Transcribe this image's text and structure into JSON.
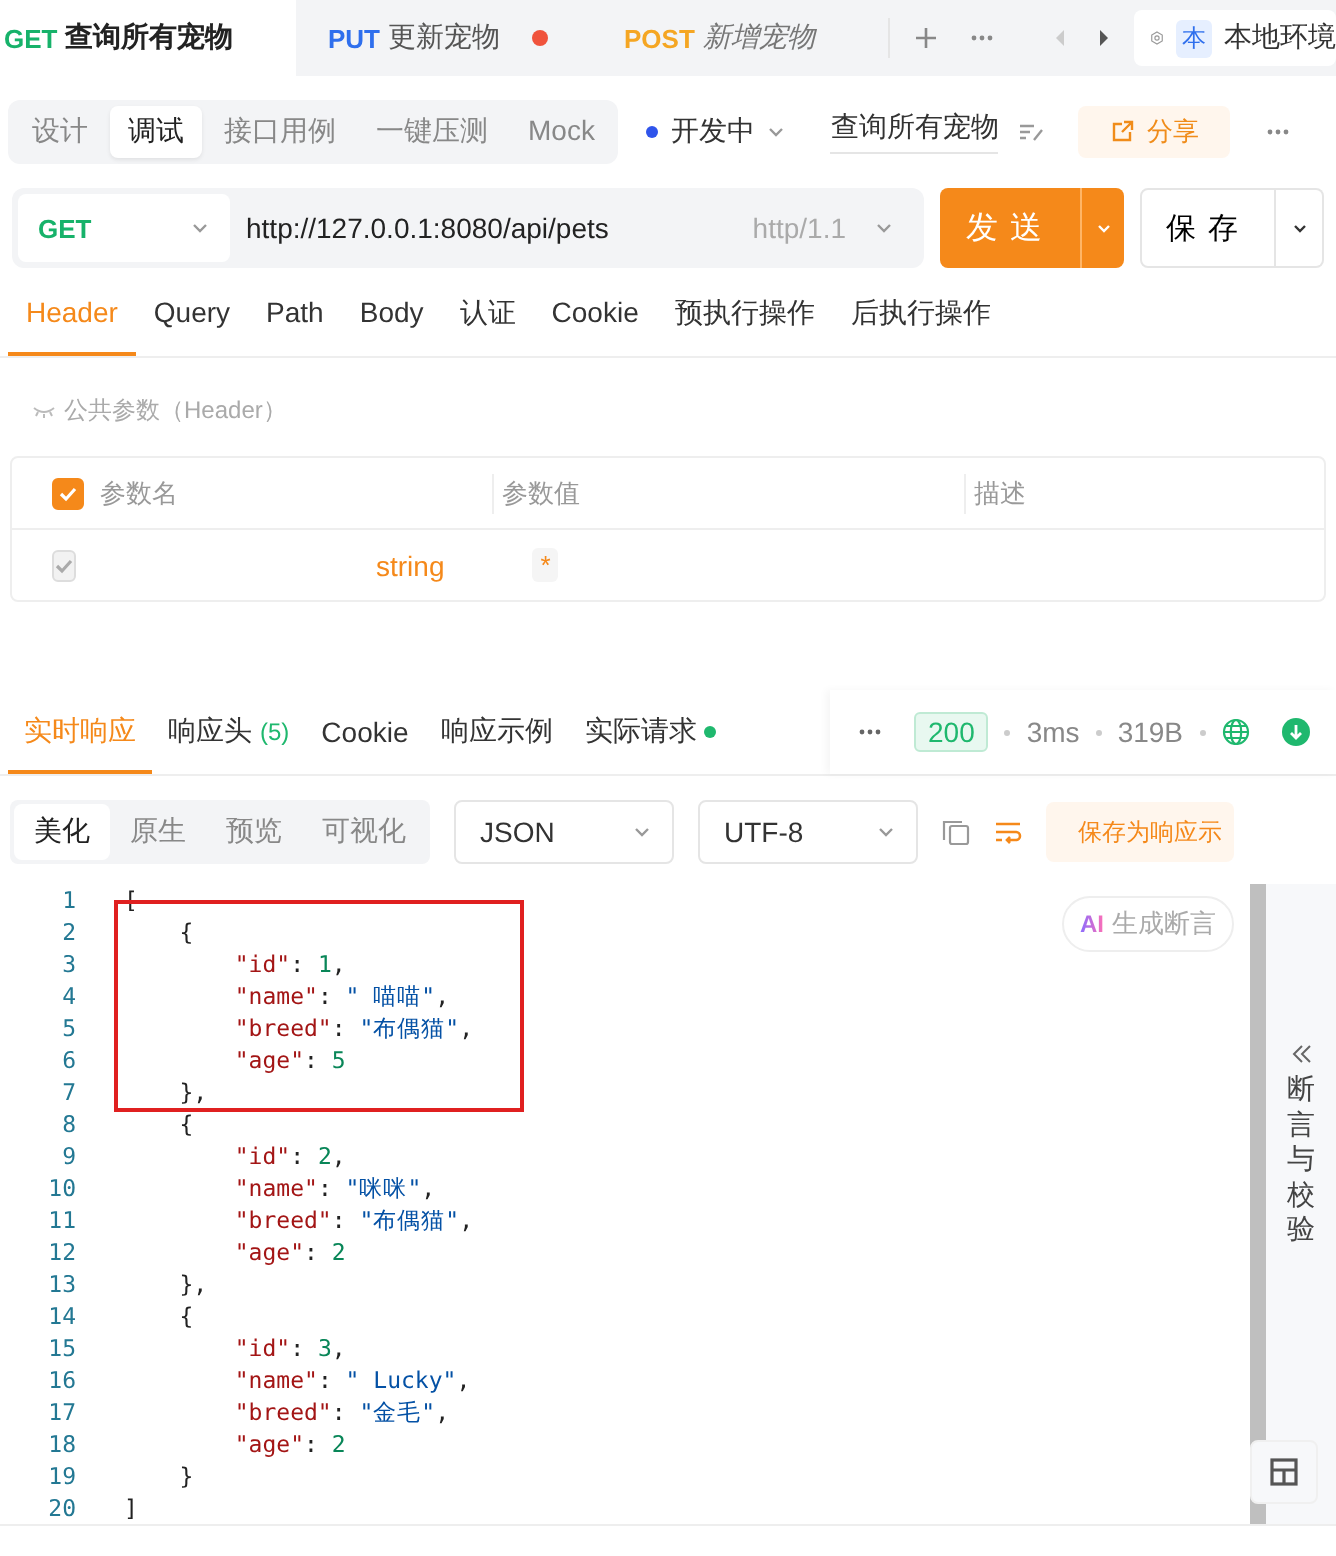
{
  "request_tabs": [
    {
      "method": "GET",
      "name": "查询所有宠物",
      "selected": true,
      "unsaved": false,
      "draft": false
    },
    {
      "method": "PUT",
      "name": "更新宠物",
      "selected": false,
      "unsaved": true,
      "draft": false
    },
    {
      "method": "POST",
      "name": "新增宠物",
      "selected": false,
      "unsaved": false,
      "draft": true
    }
  ],
  "environment": {
    "badge": "本",
    "name": "本地环境"
  },
  "modes": [
    {
      "label": "设计",
      "selected": false
    },
    {
      "label": "调试",
      "selected": true
    },
    {
      "label": "接口用例",
      "selected": false
    },
    {
      "label": "一键压测",
      "selected": false
    },
    {
      "label": "Mock",
      "selected": false
    }
  ],
  "status": "开发中",
  "api_name": "查询所有宠物",
  "share_button": "分享",
  "request": {
    "method": "GET",
    "url": "http://127.0.0.1:8080/api/pets",
    "protocol": "http/1.1"
  },
  "send_button": "发送",
  "save_button": "保存",
  "param_tabs": [
    {
      "label": "Header",
      "selected": true
    },
    {
      "label": "Query",
      "selected": false
    },
    {
      "label": "Path",
      "selected": false
    },
    {
      "label": "Body",
      "selected": false
    },
    {
      "label": "认证",
      "selected": false
    },
    {
      "label": "Cookie",
      "selected": false
    },
    {
      "label": "预执行操作",
      "selected": false
    },
    {
      "label": "后执行操作",
      "selected": false
    }
  ],
  "common_params": "公共参数（Header）",
  "params_table": {
    "all_checked": true,
    "columns": [
      "参数名",
      "参数值",
      "描述"
    ],
    "rows": [
      {
        "checked": true,
        "disabled": true,
        "type": "string",
        "required_mark": "*"
      }
    ]
  },
  "response_tabs": [
    {
      "label": "实时响应",
      "selected": true
    },
    {
      "label": "响应头",
      "count": "(5)",
      "selected": false
    },
    {
      "label": "Cookie",
      "selected": false
    },
    {
      "label": "响应示例",
      "selected": false
    },
    {
      "label": "实际请求",
      "selected": false,
      "dot": true
    }
  ],
  "response_status": {
    "code": "200",
    "time": "3ms",
    "size": "319B"
  },
  "view_modes": [
    {
      "label": "美化",
      "selected": true
    },
    {
      "label": "原生",
      "selected": false
    },
    {
      "label": "预览",
      "selected": false
    },
    {
      "label": "可视化",
      "selected": false
    }
  ],
  "format_select": "JSON",
  "encoding_select": "UTF-8",
  "save_example_button": "保存为响应示",
  "ai_button": {
    "badge": "AI",
    "label": "生成断言"
  },
  "code_lines": [
    {
      "number": "1",
      "boxed": false,
      "tokens": [
        {
          "kind": "punct",
          "text": "["
        }
      ]
    },
    {
      "number": "2",
      "boxed": true,
      "tokens": [
        {
          "kind": "punct",
          "text": "    {"
        }
      ]
    },
    {
      "number": "3",
      "boxed": true,
      "tokens": [
        {
          "kind": "key",
          "text": "        \"id\""
        },
        {
          "kind": "punct",
          "text": ": "
        },
        {
          "kind": "number",
          "text": "1"
        },
        {
          "kind": "punct",
          "text": ","
        }
      ]
    },
    {
      "number": "4",
      "boxed": true,
      "tokens": [
        {
          "kind": "key",
          "text": "        \"name\""
        },
        {
          "kind": "punct",
          "text": ": "
        },
        {
          "kind": "string",
          "text": "\" 喵喵\""
        },
        {
          "kind": "punct",
          "text": ","
        }
      ]
    },
    {
      "number": "5",
      "boxed": true,
      "tokens": [
        {
          "kind": "key",
          "text": "        \"breed\""
        },
        {
          "kind": "punct",
          "text": ": "
        },
        {
          "kind": "string",
          "text": "\"布偶猫\""
        },
        {
          "kind": "punct",
          "text": ","
        }
      ]
    },
    {
      "number": "6",
      "boxed": true,
      "tokens": [
        {
          "kind": "key",
          "text": "        \"age\""
        },
        {
          "kind": "punct",
          "text": ": "
        },
        {
          "kind": "number",
          "text": "5"
        }
      ]
    },
    {
      "number": "7",
      "boxed": true,
      "tokens": [
        {
          "kind": "punct",
          "text": "    },"
        }
      ]
    },
    {
      "number": "8",
      "boxed": false,
      "tokens": [
        {
          "kind": "punct",
          "text": "    {"
        }
      ]
    },
    {
      "number": "9",
      "boxed": false,
      "tokens": [
        {
          "kind": "key",
          "text": "        \"id\""
        },
        {
          "kind": "punct",
          "text": ": "
        },
        {
          "kind": "number",
          "text": "2"
        },
        {
          "kind": "punct",
          "text": ","
        }
      ]
    },
    {
      "number": "10",
      "boxed": false,
      "tokens": [
        {
          "kind": "key",
          "text": "        \"name\""
        },
        {
          "kind": "punct",
          "text": ": "
        },
        {
          "kind": "string",
          "text": "\"咪咪\""
        },
        {
          "kind": "punct",
          "text": ","
        }
      ]
    },
    {
      "number": "11",
      "boxed": false,
      "tokens": [
        {
          "kind": "key",
          "text": "        \"breed\""
        },
        {
          "kind": "punct",
          "text": ": "
        },
        {
          "kind": "string",
          "text": "\"布偶猫\""
        },
        {
          "kind": "punct",
          "text": ","
        }
      ]
    },
    {
      "number": "12",
      "boxed": false,
      "tokens": [
        {
          "kind": "key",
          "text": "        \"age\""
        },
        {
          "kind": "punct",
          "text": ": "
        },
        {
          "kind": "number",
          "text": "2"
        }
      ]
    },
    {
      "number": "13",
      "boxed": false,
      "tokens": [
        {
          "kind": "punct",
          "text": "    },"
        }
      ]
    },
    {
      "number": "14",
      "boxed": false,
      "tokens": [
        {
          "kind": "punct",
          "text": "    {"
        }
      ]
    },
    {
      "number": "15",
      "boxed": false,
      "tokens": [
        {
          "kind": "key",
          "text": "        \"id\""
        },
        {
          "kind": "punct",
          "text": ": "
        },
        {
          "kind": "number",
          "text": "3"
        },
        {
          "kind": "punct",
          "text": ","
        }
      ]
    },
    {
      "number": "16",
      "boxed": false,
      "tokens": [
        {
          "kind": "key",
          "text": "        \"name\""
        },
        {
          "kind": "punct",
          "text": ": "
        },
        {
          "kind": "string",
          "text": "\" Lucky\""
        },
        {
          "kind": "punct",
          "text": ","
        }
      ]
    },
    {
      "number": "17",
      "boxed": false,
      "tokens": [
        {
          "kind": "key",
          "text": "        \"breed\""
        },
        {
          "kind": "punct",
          "text": ": "
        },
        {
          "kind": "string",
          "text": "\"金毛\""
        },
        {
          "kind": "punct",
          "text": ","
        }
      ]
    },
    {
      "number": "18",
      "boxed": false,
      "tokens": [
        {
          "kind": "key",
          "text": "        \"age\""
        },
        {
          "kind": "punct",
          "text": ": "
        },
        {
          "kind": "number",
          "text": "2"
        }
      ]
    },
    {
      "number": "19",
      "boxed": false,
      "tokens": [
        {
          "kind": "punct",
          "text": "    }"
        }
      ]
    },
    {
      "number": "20",
      "boxed": false,
      "tokens": [
        {
          "kind": "punct",
          "text": "]"
        }
      ]
    }
  ],
  "side_panel": "断言与校验"
}
